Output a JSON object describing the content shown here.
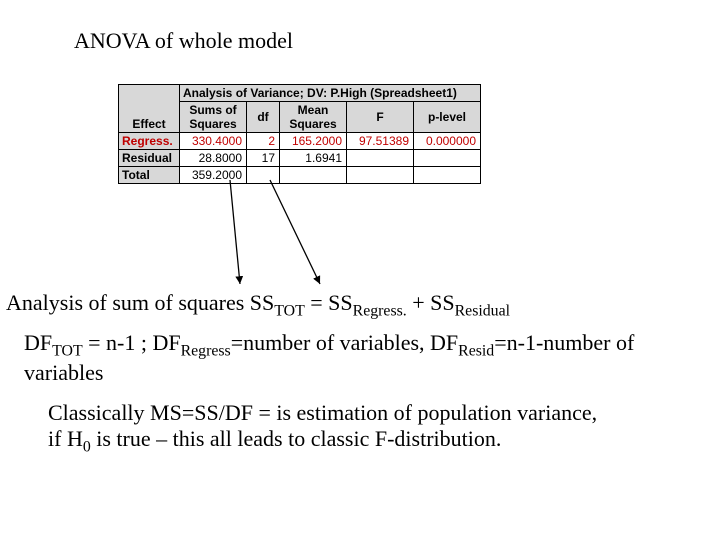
{
  "title": "ANOVA of whole model",
  "table": {
    "caption": "Analysis of Variance; DV: P.High (Spreadsheet1)",
    "corner": "Effect",
    "headers": [
      "Sums of Squares",
      "df",
      "Mean Squares",
      "F",
      "p-level"
    ],
    "rows": [
      {
        "label": "Regress.",
        "ss": "330.4000",
        "df": "2",
        "ms": "165.2000",
        "f": "97.51389",
        "p": "0.000000",
        "hl": true
      },
      {
        "label": "Residual",
        "ss": "28.8000",
        "df": "17",
        "ms": "1.6941",
        "f": "",
        "p": "",
        "hl": false
      },
      {
        "label": "Total",
        "ss": "359.2000",
        "df": "",
        "ms": "",
        "f": "",
        "p": "",
        "hl": false
      }
    ]
  },
  "body": {
    "line1_pre": "Analysis of sum of squares SS",
    "line1_s1": "TOT",
    "line1_mid1": " = SS",
    "line1_s2": "Regress.",
    "line1_mid2": " + SS",
    "line1_s3": "Residual",
    "line2_a": "DF",
    "line2_s1": "TOT",
    "line2_b": " = n-1 ; DF",
    "line2_s2": "Regress",
    "line2_c": "=number of variables, DF",
    "line2_s3": "Resid",
    "line2_d": "=n-1-number of variables",
    "line3_a": "Classically MS=SS/DF = is estimation of population variance, if H",
    "line3_s1": "0",
    "line3_b": " is true – this all leads to classic F-distribution."
  },
  "chart_data": {
    "type": "table",
    "title": "Analysis of Variance; DV: P.High (Spreadsheet1)",
    "columns": [
      "Effect",
      "Sums of Squares",
      "df",
      "Mean Squares",
      "F",
      "p-level"
    ],
    "rows": [
      [
        "Regress.",
        330.4,
        2,
        165.2,
        97.51389,
        0.0
      ],
      [
        "Residual",
        28.8,
        17,
        1.6941,
        null,
        null
      ],
      [
        "Total",
        359.2,
        null,
        null,
        null,
        null
      ]
    ]
  }
}
